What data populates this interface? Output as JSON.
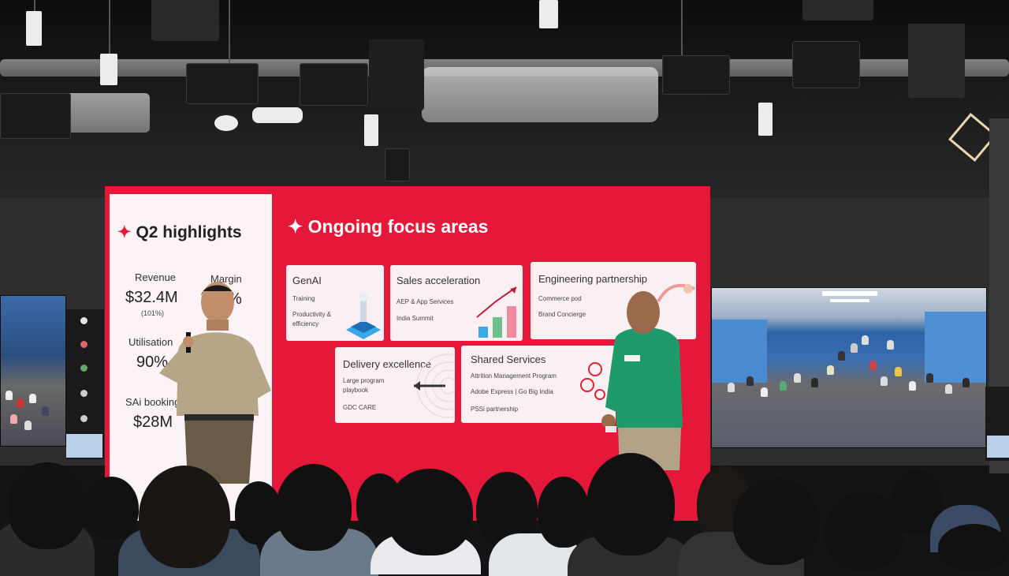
{
  "slide": {
    "left_title": "Q2 highlights",
    "revenue_label": "Revenue",
    "revenue_value": "$32.4M",
    "revenue_sub": "(101%)",
    "margin_label": "Margin",
    "margin_value": "%",
    "utilisation_label": "Utilisation",
    "utilisation_value": "90%",
    "bookings_label": "SAi booking",
    "bookings_value": "$28M",
    "right_title": "Ongoing focus areas",
    "cards": {
      "genai": {
        "title": "GenAI",
        "items": [
          "Training",
          "Productivity &",
          "efficiency"
        ]
      },
      "sales": {
        "title": "Sales acceleration",
        "items": [
          "AEP & App Services",
          "India Summit"
        ]
      },
      "engineering": {
        "title": "Engineering partnership",
        "items": [
          "Commerce pod",
          "Brand Concierge"
        ]
      },
      "delivery": {
        "title": "Delivery excellence",
        "items": [
          "Large program",
          "playbook",
          "GDC CARE"
        ]
      },
      "shared": {
        "title": "Shared Services",
        "items": [
          "Attrition Management Program",
          "Adobe Express | Go Big India",
          "PSSi partnership"
        ]
      }
    }
  },
  "colors": {
    "screen_red": "#e5183a",
    "panel_light": "#fbf3f5",
    "card_bg": "#faf0f3",
    "side_screen_blue": "#1d3a66",
    "speaker_shirt_green": "#1f9a6b"
  },
  "icons": [
    "sparkle-icon",
    "trend-up-chart-icon",
    "dartboard-icon",
    "servers-illustration-icon"
  ]
}
